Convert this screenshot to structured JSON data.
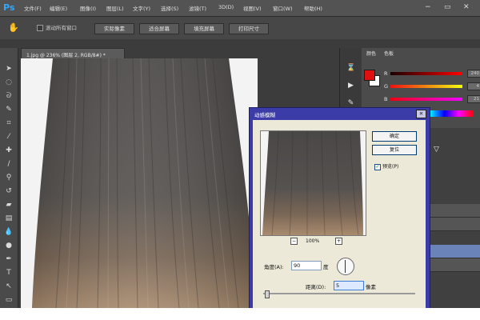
{
  "app": {
    "logo": "Ps"
  },
  "menubar": {
    "items": [
      "文件(F)",
      "编辑(E)",
      "图像(I)",
      "图层(L)",
      "文字(Y)",
      "选择(S)",
      "滤镜(T)",
      "3D(D)",
      "视图(V)",
      "窗口(W)",
      "帮助(H)"
    ],
    "window_controls": [
      "−",
      "▭",
      "✕"
    ]
  },
  "options_bar": {
    "scroll_all_label": "滚动所有窗口",
    "buttons": [
      "实际像素",
      "适合屏幕",
      "填充屏幕",
      "打印尺寸"
    ]
  },
  "document": {
    "tab_title": "1.jpg @ 236% (图层 2, RGB/8#) *"
  },
  "color_panel": {
    "tabs": [
      "颜色",
      "色板"
    ],
    "foreground": "#e01010",
    "background": "#ffffff",
    "channels": [
      {
        "label": "R",
        "value": "240"
      },
      {
        "label": "G",
        "value": "4"
      },
      {
        "label": "B",
        "value": "21"
      }
    ]
  },
  "dialog": {
    "title": "动感模糊",
    "ok_label": "确定",
    "cancel_label": "复位",
    "preview_label": "预览(P)",
    "preview_checked": true,
    "zoom_minus": "−",
    "zoom_level": "100%",
    "zoom_plus": "+",
    "angle_label": "角度(A):",
    "angle_value": "90",
    "angle_unit": "度",
    "distance_label": "距离(D):",
    "distance_value": "5",
    "distance_unit": "像素"
  },
  "layers_panel": {
    "rows": [
      "",
      "",
      "",
      ""
    ]
  },
  "colors": {
    "accent": "#31a8ff",
    "dialog_title_bar": "#3c3ca8"
  }
}
